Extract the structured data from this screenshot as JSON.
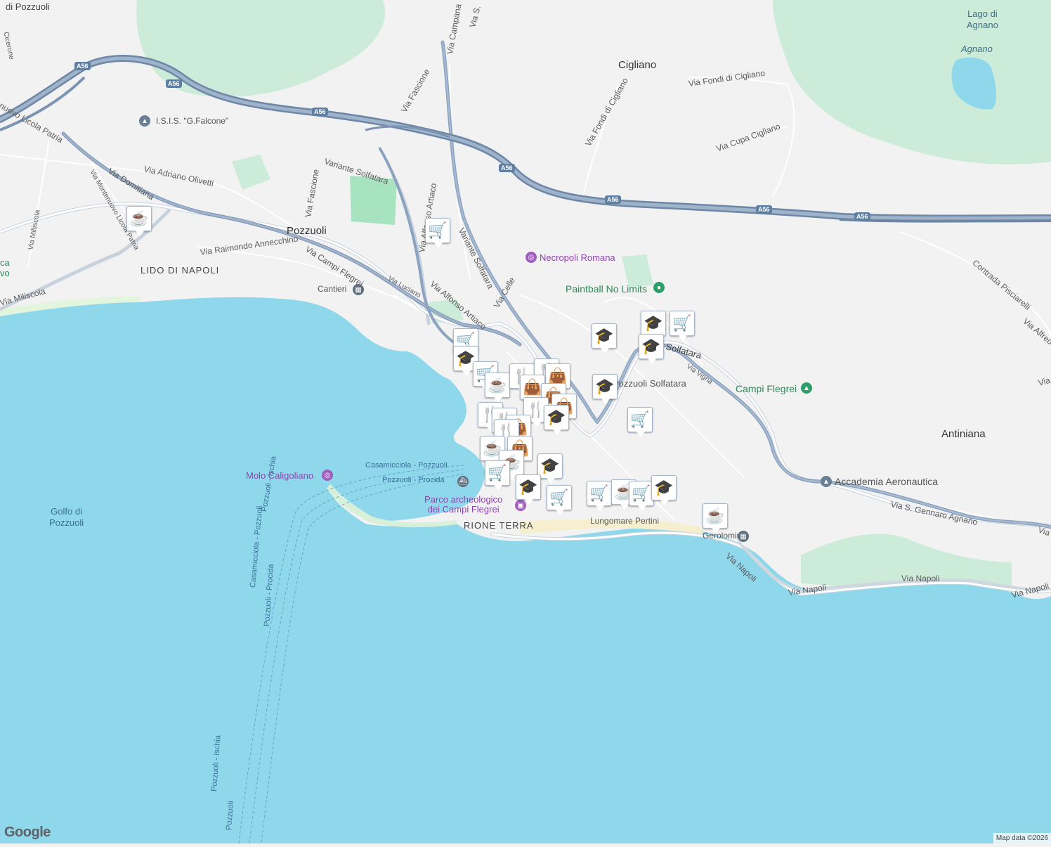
{
  "map": {
    "colors": {
      "land": "#f2f2f3",
      "sea": "#8fd8ec",
      "park": "#cdebd9",
      "park_dark": "#a6e3be",
      "beach": "#f6efcf",
      "motorway": "#8ca3bf",
      "motorway_edge": "#6e87a6",
      "road": "#ffffff",
      "marker_icon": "#0c3a5e"
    },
    "places": {
      "pozzuoli": "Pozzuoli",
      "cigliano": "Cigliano",
      "antiniana": "Antiniana",
      "lido_di_napoli": "LIDO DI NAPOLI",
      "rione_terra": "RIONE TERRA",
      "lago_di_agnano": "Lago di\nAgnano",
      "agnano": "Agnano",
      "golfo_di_pozzuoli": "Golfo di\nPozzuoli",
      "di_pozzuoli_top": "di Pozzuoli",
      "cicerone": "Cicerone",
      "ca_vo": "ca\nvo"
    },
    "pois": {
      "necropoli_romana": "Necropoli Romana",
      "paintball": "Paintball No Limits",
      "campi_flegrei": "Campi Flegrei",
      "molo_caligoliano": "Molo Caligoliano",
      "parco_archeologico": "Parco archeologico\ndei Campi Flegrei",
      "accademia_aeronautica": "Accademia Aeronautica",
      "isis_falcone": "I.S.I.S. \"G.Falcone\"",
      "pozzuoli_solfatara": "Pozzuoli Solfatara",
      "cantieri": "Cantieri",
      "gerolomini": "Gerolomini"
    },
    "roads": {
      "via_campi_flegrei": "Via Campi Flegrei",
      "via_domitiana": "Via Domitiana",
      "via_adriano_olivetti": "Via Adriano Olivetti",
      "via_raimondo_annecchino": "Via Raimondo Annecchino",
      "via_fascione_left": "Via Fascione",
      "via_fascione_top": "Via Fascione",
      "via_campana": "Via Campana",
      "via_s": "Via S.",
      "variante_solfatara_1": "Variante Solfatara",
      "variante_solfatara_2": "Variante Solfatara",
      "via_alfonso_artiaco_1": "Via Alfonso Artiaco",
      "via_alfonso_artiaco_2": "Via Alfonso Artiaco",
      "via_celle": "Via Celle",
      "via_luciano": "Via Luciano",
      "via_miliscola": "Via Miliscola",
      "via_milliscola": "Via Milliscola",
      "via_montenuovo": "Via Montenuovo Licola Patria",
      "licola_patria": "nuovo Licola Patria",
      "via_fondi_di_cigliano_1": "Via Fondi di Cigliano",
      "via_fondi_di_cigliano_2": "Via Fondi di Cigliano",
      "via_cupa_cigliano": "Via Cupa Cigliano",
      "solfatara": "Solfatara",
      "via_vigna": "Via Vigna",
      "contrada_pisciarelli": "Contrada Pisciarelli",
      "via_alfredo": "Via Alfred",
      "via_s_gennaro_agnano": "Via S. Gennaro Agnano",
      "lungomare_pertini": "Lungomare Pertini",
      "via_napoli_1": "Via Napoli",
      "via_napoli_2": "Via Napoli",
      "via_napoli_3": "Via Napoli",
      "via_napoli_4": "Via Napoli",
      "via_right_edge": "Via",
      "via_right_edge2": "Via"
    },
    "ferries": {
      "casamicciola_pozzuoli": "Casamicciola - Pozzuoli",
      "pozzuoli_procida": "Pozzuoli - Procida",
      "pozzuoli_ischia": "Pozzuoli - Ischia",
      "casamicciola_pozzuoli_2": "Casamicciola - Pozzuoli",
      "pozzuoli_procida_2": "Pozzuoli - Procida",
      "pozzuoli_ischia_2": "Pozzuoli - Ischia",
      "pozzuoli_bottom": "Pozzuoli"
    },
    "shields": [
      "A56",
      "A56",
      "A56",
      "A56",
      "A56",
      "A56",
      "A56"
    ],
    "marker_icons": {
      "coffee": "☕",
      "cart": "🛒",
      "school": "🎓",
      "restaurant": "🍴",
      "shopping": "👜"
    },
    "footer": {
      "logo": "Google",
      "attribution": "Map data ©2026"
    }
  }
}
